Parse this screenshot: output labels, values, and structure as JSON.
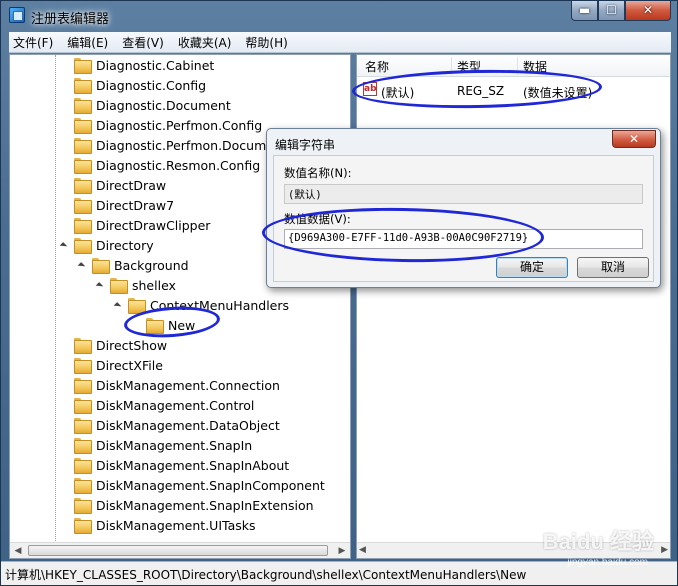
{
  "window": {
    "title": "注册表编辑器",
    "caption_minimize": "▬",
    "caption_maximize": "☐",
    "caption_close": "✕"
  },
  "menu": [
    "文件(F)",
    "编辑(E)",
    "查看(V)",
    "收藏夹(A)",
    "帮助(H)"
  ],
  "tree": [
    {
      "label": "Diagnostic.Cabinet",
      "expander": "closed"
    },
    {
      "label": "Diagnostic.Config",
      "expander": "closed"
    },
    {
      "label": "Diagnostic.Document",
      "expander": "closed"
    },
    {
      "label": "Diagnostic.Perfmon.Config",
      "expander": "closed"
    },
    {
      "label": "Diagnostic.Perfmon.Document",
      "expander": "closed"
    },
    {
      "label": "Diagnostic.Resmon.Config",
      "expander": "closed"
    },
    {
      "label": "DirectDraw",
      "expander": "closed"
    },
    {
      "label": "DirectDraw7",
      "expander": "closed"
    },
    {
      "label": "DirectDrawClipper",
      "expander": "closed"
    },
    {
      "label": "Directory",
      "expander": "open"
    },
    {
      "label": "Background",
      "expander": "open"
    },
    {
      "label": "shellex",
      "expander": "open"
    },
    {
      "label": "ContextMenuHandlers",
      "expander": "open"
    },
    {
      "label": "New",
      "expander": "none"
    },
    {
      "label": "DirectShow",
      "expander": "closed"
    },
    {
      "label": "DirectXFile",
      "expander": "closed"
    },
    {
      "label": "DiskManagement.Connection",
      "expander": "none"
    },
    {
      "label": "DiskManagement.Control",
      "expander": "closed"
    },
    {
      "label": "DiskManagement.DataObject",
      "expander": "closed"
    },
    {
      "label": "DiskManagement.SnapIn",
      "expander": "closed"
    },
    {
      "label": "DiskManagement.SnapInAbout",
      "expander": "closed"
    },
    {
      "label": "DiskManagement.SnapInComponent",
      "expander": "closed"
    },
    {
      "label": "DiskManagement.SnapInExtension",
      "expander": "closed"
    },
    {
      "label": "DiskManagement.UITasks",
      "expander": "closed"
    }
  ],
  "list": {
    "columns": [
      "名称",
      "类型",
      "数据"
    ],
    "rows": [
      {
        "name": "(默认)",
        "type": "REG_SZ",
        "data": "(数值未设置)",
        "icon": "ab"
      }
    ]
  },
  "dialog": {
    "title": "编辑字符串",
    "close": "✕",
    "name_label": "数值名称(N):",
    "name_value": "(默认)",
    "data_label": "数值数据(V):",
    "data_value": "{D969A300-E7FF-11d0-A93B-00A0C90F2719}",
    "ok": "确定",
    "cancel": "取消"
  },
  "status": "计算机\\HKEY_CLASSES_ROOT\\Directory\\Background\\shellex\\ContextMenuHandlers\\New",
  "scroll_arrows": {
    "left": "◀",
    "right": "▶"
  },
  "watermark": {
    "main": "Baidu 经验",
    "sub": "jingyan.baidu.com"
  },
  "colors": {
    "annotation_ink": "#1f27d6",
    "titlebar": "#496c91"
  }
}
